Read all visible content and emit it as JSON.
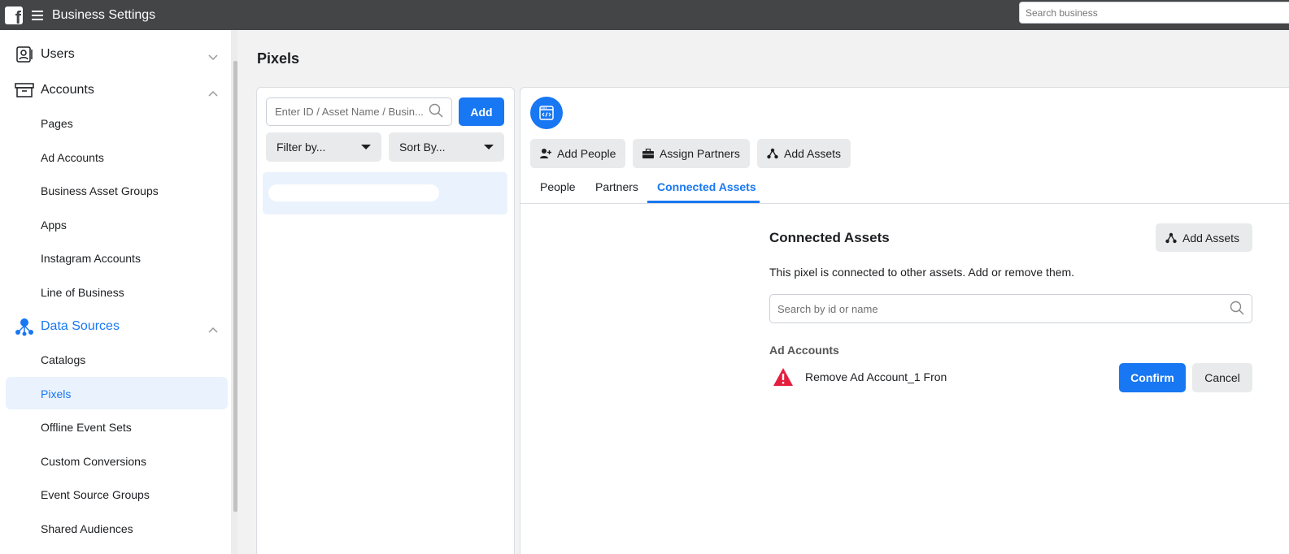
{
  "topbar": {
    "logo_letter": "f",
    "title": "Business Settings",
    "search_placeholder": "Search business"
  },
  "sidebar": {
    "users": "Users",
    "accounts": {
      "label": "Accounts",
      "items": [
        "Pages",
        "Ad Accounts",
        "Business Asset Groups",
        "Apps",
        "Instagram Accounts",
        "Line of Business"
      ]
    },
    "data_sources": {
      "label": "Data Sources",
      "items": [
        "Catalogs",
        "Pixels",
        "Offline Event Sets",
        "Custom Conversions",
        "Event Source Groups",
        "Shared Audiences"
      ],
      "selected": "Pixels"
    }
  },
  "page": {
    "title": "Pixels"
  },
  "left_panel": {
    "search_placeholder": "Enter ID / Asset Name / Busin...",
    "add_label": "Add",
    "filter_label": "Filter by...",
    "sort_label": "Sort By..."
  },
  "right_panel": {
    "buttons": {
      "add_people": "Add People",
      "assign_partners": "Assign Partners",
      "add_assets": "Add Assets"
    },
    "tabs": [
      "People",
      "Partners",
      "Connected Assets"
    ],
    "active_tab": "Connected Assets",
    "connected_assets": {
      "title": "Connected Assets",
      "add_assets_label": "Add Assets",
      "description": "This pixel is connected to other assets. Add or remove them.",
      "search_placeholder": "Search by id or name",
      "section_title": "Ad Accounts",
      "warning_text": "Remove Ad Account_1 Fron",
      "confirm_label": "Confirm",
      "cancel_label": "Cancel"
    }
  },
  "colors": {
    "accent": "#1877f2",
    "topbar": "#444546",
    "warning": "#e41e3f"
  }
}
